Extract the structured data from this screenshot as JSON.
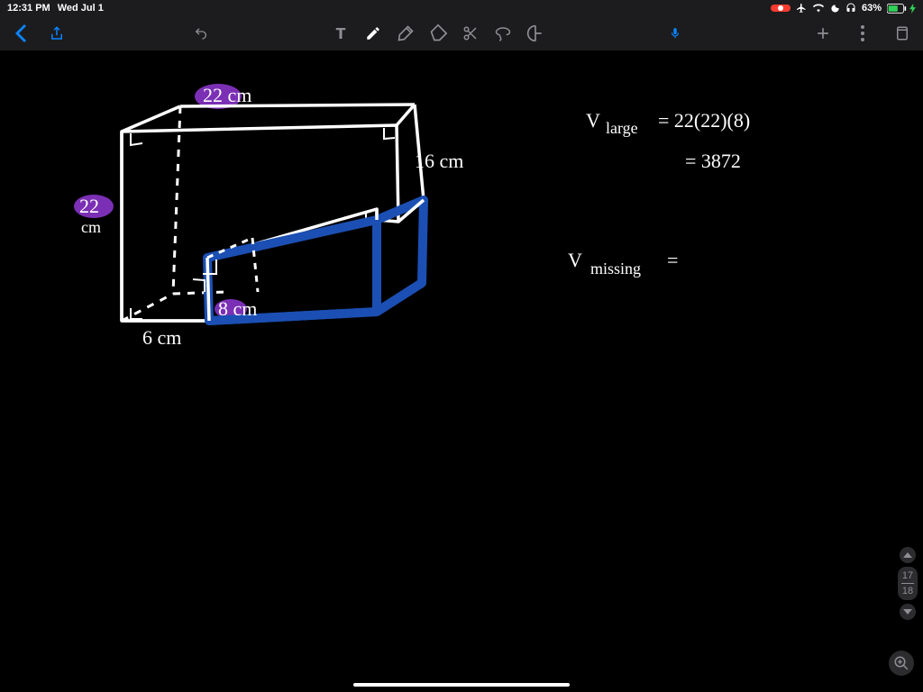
{
  "status": {
    "time": "12:31 PM",
    "date": "Wed Jul 1",
    "battery": "63%"
  },
  "pages": {
    "current": "17",
    "total": "18"
  },
  "labels": {
    "top_width": "22 cm",
    "left_height": "22",
    "left_height_unit": "cm",
    "right_height": "16 cm",
    "bottom_left": "6 cm",
    "inner_depth": "8 cm"
  },
  "equations": {
    "vlarge_lhs": "V",
    "vlarge_sub": "large",
    "vlarge_rhs": "= 22(22)(8)",
    "vlarge_result": "= 3872",
    "vmissing_lhs": "V",
    "vmissing_sub": "missing",
    "vmissing_rhs": "="
  }
}
